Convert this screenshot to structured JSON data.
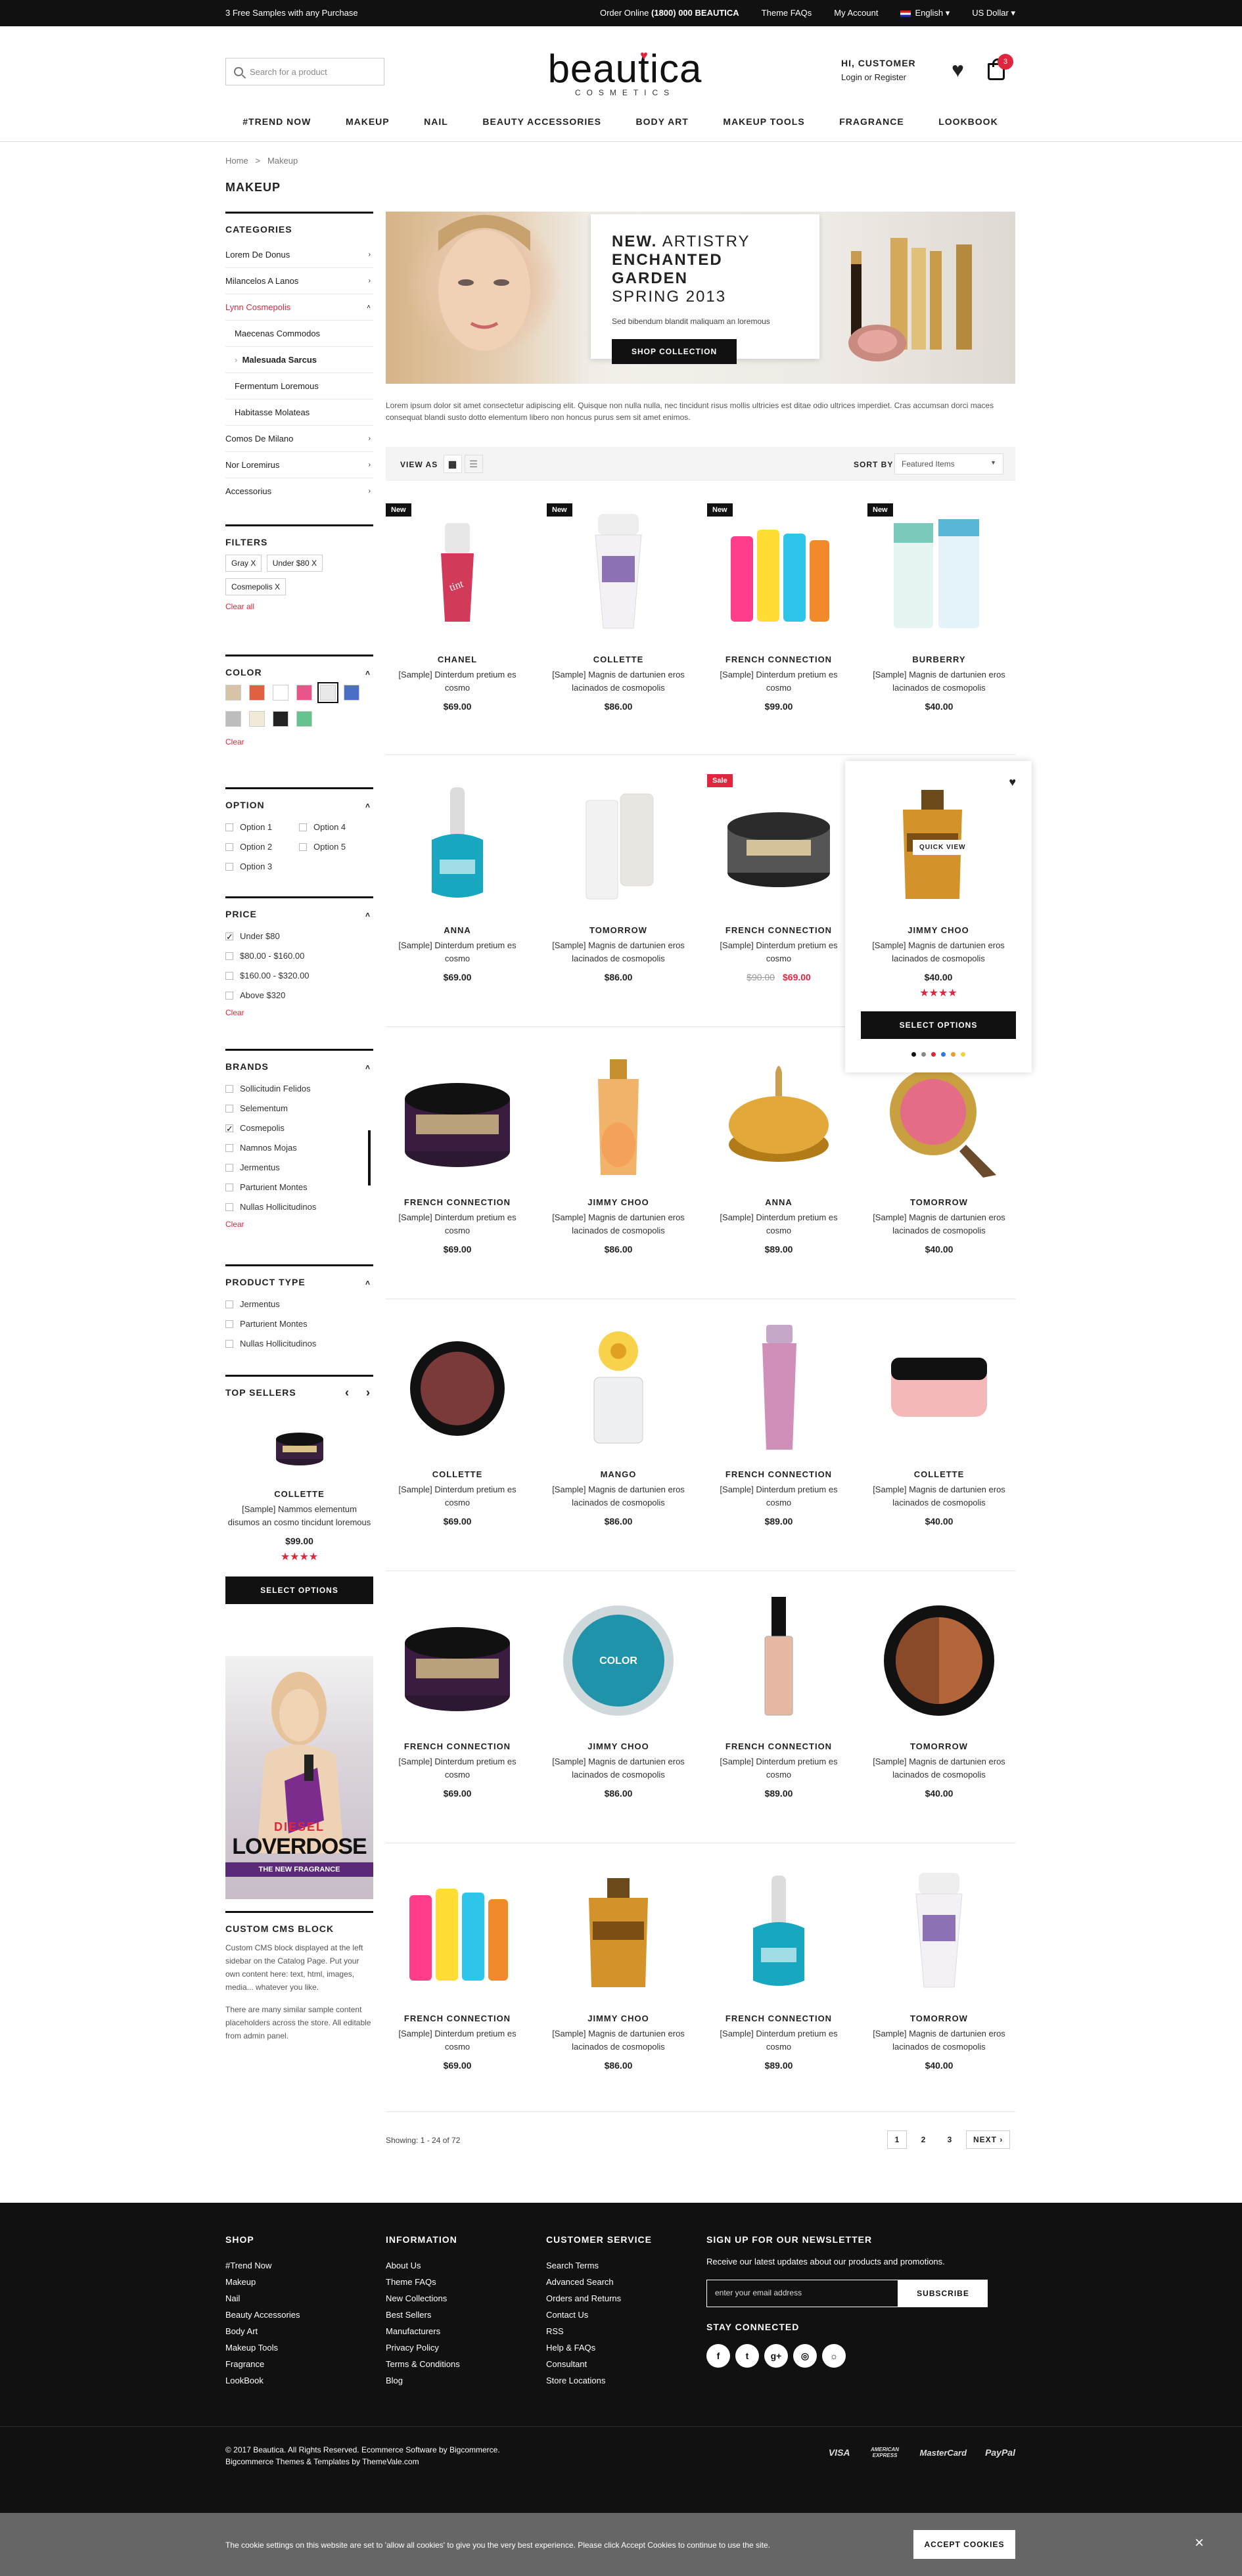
{
  "topbar": {
    "promo": "3 Free Samples with any Purchase",
    "order_label": "Order Online",
    "phone": "(1800) 000 BEAUTICA",
    "faqs": "Theme FAQs",
    "account": "My Account",
    "language": "English",
    "currency": "US Dollar"
  },
  "header": {
    "search_placeholder": "Search for a product",
    "logo": "beautica",
    "logo_sub": "COSMETICS",
    "greeting": "HI, CUSTOMER",
    "login": "Login or Register",
    "cart_count": "3"
  },
  "nav": [
    "#TREND NOW",
    "MAKEUP",
    "NAIL",
    "BEAUTY ACCESSORIES",
    "BODY ART",
    "MAKEUP TOOLS",
    "FRAGRANCE",
    "LOOKBOOK"
  ],
  "breadcrumb": {
    "home": "Home",
    "sep": ">",
    "current": "Makeup"
  },
  "page_title": "MAKEUP",
  "sidebar": {
    "categories_title": "CATEGORIES",
    "categories": [
      {
        "label": "Lorem De Donus",
        "arrow": "›"
      },
      {
        "label": "Milancelos A Lanos",
        "arrow": "›"
      },
      {
        "label": "Lynn Cosmepolis",
        "arrow": "˄"
      },
      {
        "label": "Maecenas Commodos",
        "arrow": ""
      },
      {
        "label": "Malesuada Sarcus",
        "arrow": ""
      },
      {
        "label": "Fermentum Loremous",
        "arrow": ""
      },
      {
        "label": "Habitasse Molateas",
        "arrow": ""
      },
      {
        "label": "Comos De Milano",
        "arrow": "›"
      },
      {
        "label": "Nor Loremirus",
        "arrow": "›"
      },
      {
        "label": "Accessorius",
        "arrow": "›"
      }
    ],
    "filters_title": "FILTERS",
    "chips": [
      "Gray X",
      "Under $80 X",
      "Cosmepolis X"
    ],
    "clear_all": "Clear all",
    "color_title": "COLOR",
    "colors": [
      "#d7c3a5",
      "#e06040",
      "#ffffff",
      "#e8558b",
      "#e9e9e9",
      "#4a6fc4",
      "#bdbdbd",
      "#f2ead9",
      "#222222",
      "#66c28f"
    ],
    "clear": "Clear",
    "option_title": "OPTION",
    "options": [
      "Option 1",
      "Option 4",
      "Option 2",
      "Option 5",
      "Option 3"
    ],
    "price_title": "PRICE",
    "prices": [
      "Under $80",
      "$80.00 - $160.00",
      "$160.00 - $320.00",
      "Above $320"
    ],
    "brands_title": "BRANDS",
    "brands": [
      "Sollicitudin Felidos",
      "Selementum",
      "Cosmepolis",
      "Namnos Mojas",
      "Jermentus",
      "Parturient Montes",
      "Nullas Hollicitudinos"
    ],
    "type_title": "PRODUCT TYPE",
    "types": [
      "Jermentus",
      "Parturient Montes",
      "Nullas Hollicitudinos"
    ],
    "top_title": "TOP SELLERS",
    "top": {
      "brand": "COLLETTE",
      "name": "[Sample] Nammos elementum disumos an cosmo tincidunt loremous",
      "price": "$99.00",
      "stars": "★★★★",
      "button": "SELECT OPTIONS"
    },
    "ad": {
      "brand": "DIESEL",
      "title": "LOVERDOSE",
      "sub": "THE NEW FRAGRANCE"
    },
    "cms_title": "CUSTOM CMS BLOCK",
    "cms_p1": "Custom CMS block displayed at the left sidebar on the Catalog Page. Put your own content here: text, html, images, media... whatever you like.",
    "cms_p2": "There are many similar sample content placeholders across the store. All editable from admin panel."
  },
  "banner": {
    "l1a": "NEW.",
    "l1b": " ARTISTRY",
    "l2": "ENCHANTED GARDEN",
    "l3": "SPRING 2013",
    "sub": "Sed bibendum blandit maliquam an loremous",
    "button": "SHOP COLLECTION"
  },
  "intro": "Lorem ipsum dolor sit amet consectetur adipiscing elit. Quisque non nulla nulla, nec tincidunt risus mollis ultricies est ditae odio ultrices imperdiet. Cras accumsan dorci maces consequat blandi susto dotto elementum libero non honcus purus sem sit amet enimos.",
  "toolbar": {
    "view_as": "VIEW AS",
    "sort_by": "SORT BY",
    "sort_value": "Featured Items"
  },
  "products": [
    {
      "tag": "New",
      "brand": "CHANEL",
      "name": "[Sample] Dinterdum pretium es cosmo",
      "price": "$69.00",
      "img": "lipstick-tint"
    },
    {
      "tag": "New",
      "brand": "COLLETTE",
      "name": "[Sample] Magnis de dartunien eros lacinados de cosmopolis",
      "price": "$86.00",
      "img": "tube-purple"
    },
    {
      "tag": "New",
      "brand": "FRENCH CONNECTION",
      "name": "[Sample] Dinterdum pretium es cosmo",
      "price": "$99.00",
      "img": "lip-balms"
    },
    {
      "tag": "New",
      "brand": "BURBERRY",
      "name": "[Sample] Magnis de dartunien eros lacinados de cosmopolis",
      "price": "$40.00",
      "img": "tubes-teal"
    },
    {
      "tag": "",
      "brand": "ANNA",
      "name": "[Sample] Dinterdum pretium es cosmo",
      "price": "$69.00",
      "img": "nail-teal"
    },
    {
      "tag": "",
      "brand": "TOMORROW",
      "name": "[Sample] Magnis de dartunien eros lacinados de cosmopolis",
      "price": "$86.00",
      "img": "tubes-white"
    },
    {
      "tag": "Sale",
      "brand": "FRENCH CONNECTION",
      "name": "[Sample] Dinterdum pretium es cosmo",
      "price_old": "$90.00",
      "price": "$69.00",
      "img": "jar-black"
    },
    {
      "tag": "",
      "brand": "JIMMY CHOO",
      "name": "[Sample] Magnis de dartunien eros lacinados de cosmopolis",
      "price": "$40.00",
      "img": "bottle-gold",
      "stars": "★★★★",
      "quick": "QUICK VIEW",
      "button": "SELECT OPTIONS"
    },
    {
      "tag": "",
      "brand": "FRENCH CONNECTION",
      "name": "[Sample] Dinterdum pretium es cosmo",
      "price": "$69.00",
      "img": "jar-loreal"
    },
    {
      "tag": "",
      "brand": "JIMMY CHOO",
      "name": "[Sample] Magnis de dartunien eros lacinados de cosmopolis",
      "price": "$86.00",
      "img": "bottle-orange"
    },
    {
      "tag": "",
      "brand": "ANNA",
      "name": "[Sample] Dinterdum pretium es cosmo",
      "price": "$89.00",
      "img": "jar-gold"
    },
    {
      "tag": "",
      "brand": "TOMORROW",
      "name": "[Sample] Magnis de dartunien eros lacinados de cosmopolis",
      "price": "$40.00",
      "img": "compact-pink"
    },
    {
      "tag": "",
      "brand": "COLLETTE",
      "name": "[Sample] Dinterdum pretium es cosmo",
      "price": "$69.00",
      "img": "pot-brown"
    },
    {
      "tag": "",
      "brand": "MANGO",
      "name": "[Sample] Magnis de dartunien eros lacinados de cosmopolis",
      "price": "$86.00",
      "img": "perfume-daisy"
    },
    {
      "tag": "",
      "brand": "FRENCH CONNECTION",
      "name": "[Sample] Dinterdum pretium es cosmo",
      "price": "$89.00",
      "img": "tube-pink"
    },
    {
      "tag": "",
      "brand": "COLLETTE",
      "name": "[Sample] Magnis de dartunien eros lacinados de cosmopolis",
      "price": "$40.00",
      "img": "pot-pink"
    },
    {
      "tag": "",
      "brand": "FRENCH CONNECTION",
      "name": "[Sample] Dinterdum pretium es cosmo",
      "price": "$69.00",
      "img": "jar-loreal"
    },
    {
      "tag": "",
      "brand": "JIMMY CHOO",
      "name": "[Sample] Magnis de dartunien eros lacinados de cosmopolis",
      "price": "$86.00",
      "img": "tin-blue"
    },
    {
      "tag": "",
      "brand": "FRENCH CONNECTION",
      "name": "[Sample] Dinterdum pretium es cosmo",
      "price": "$89.00",
      "img": "foundation"
    },
    {
      "tag": "",
      "brand": "TOMORROW",
      "name": "[Sample] Magnis de dartunien eros lacinados de cosmopolis",
      "price": "$40.00",
      "img": "compact-bronze"
    },
    {
      "tag": "",
      "brand": "FRENCH CONNECTION",
      "name": "[Sample] Dinterdum pretium es cosmo",
      "price": "$69.00",
      "img": "lip-balms"
    },
    {
      "tag": "",
      "brand": "JIMMY CHOO",
      "name": "[Sample] Magnis de dartunien eros lacinados de cosmopolis",
      "price": "$86.00",
      "img": "bottle-gold"
    },
    {
      "tag": "",
      "brand": "FRENCH CONNECTION",
      "name": "[Sample] Dinterdum pretium es cosmo",
      "price": "$89.00",
      "img": "nail-teal"
    },
    {
      "tag": "",
      "brand": "TOMORROW",
      "name": "[Sample] Magnis de dartunien eros lacinados de cosmopolis",
      "price": "$40.00",
      "img": "tube-purple"
    }
  ],
  "pagination": {
    "showing": "Showing: 1 - 24 of 72",
    "pages": [
      "1",
      "2",
      "3"
    ],
    "next": "NEXT"
  },
  "footer": {
    "shop_title": "SHOP",
    "shop": [
      "#Trend Now",
      "Makeup",
      "Nail",
      "Beauty Accessories",
      "Body Art",
      "Makeup Tools",
      "Fragrance",
      "LookBook"
    ],
    "info_title": "INFORMATION",
    "info": [
      "About Us",
      "Theme FAQs",
      "New Collections",
      "Best Sellers",
      "Manufacturers",
      "Privacy Policy",
      "Terms & Conditions",
      "Blog"
    ],
    "cs_title": "CUSTOMER SERVICE",
    "cs": [
      "Search Terms",
      "Advanced Search",
      "Orders and Returns",
      "Contact Us",
      "RSS",
      "Help & FAQs",
      "Consultant",
      "Store Locations"
    ],
    "news_title": "SIGN UP FOR OUR NEWSLETTER",
    "news_text": "Receive our latest updates about our products and promotions.",
    "email_placeholder": "enter your email address",
    "subscribe": "SUBSCRIBE",
    "stay": "STAY CONNECTED",
    "socials": [
      "f",
      "t",
      "g+",
      "◎",
      "☼"
    ],
    "copy1": "© 2017 Beautica. All Rights Reserved. Ecommerce Software by Bigcommerce.",
    "copy2": "Bigcommerce Themes & Templates by ThemeVale.com",
    "payments": [
      "VISA",
      "AMERICAN EXPRESS",
      "MasterCard",
      "PayPal"
    ]
  },
  "cookie": {
    "text": "The cookie settings on this website are set to 'allow all cookies' to give you the very best experience. Please click Accept Cookies to continue to use the site.",
    "button": "ACCEPT COOKIES",
    "close": "×"
  }
}
